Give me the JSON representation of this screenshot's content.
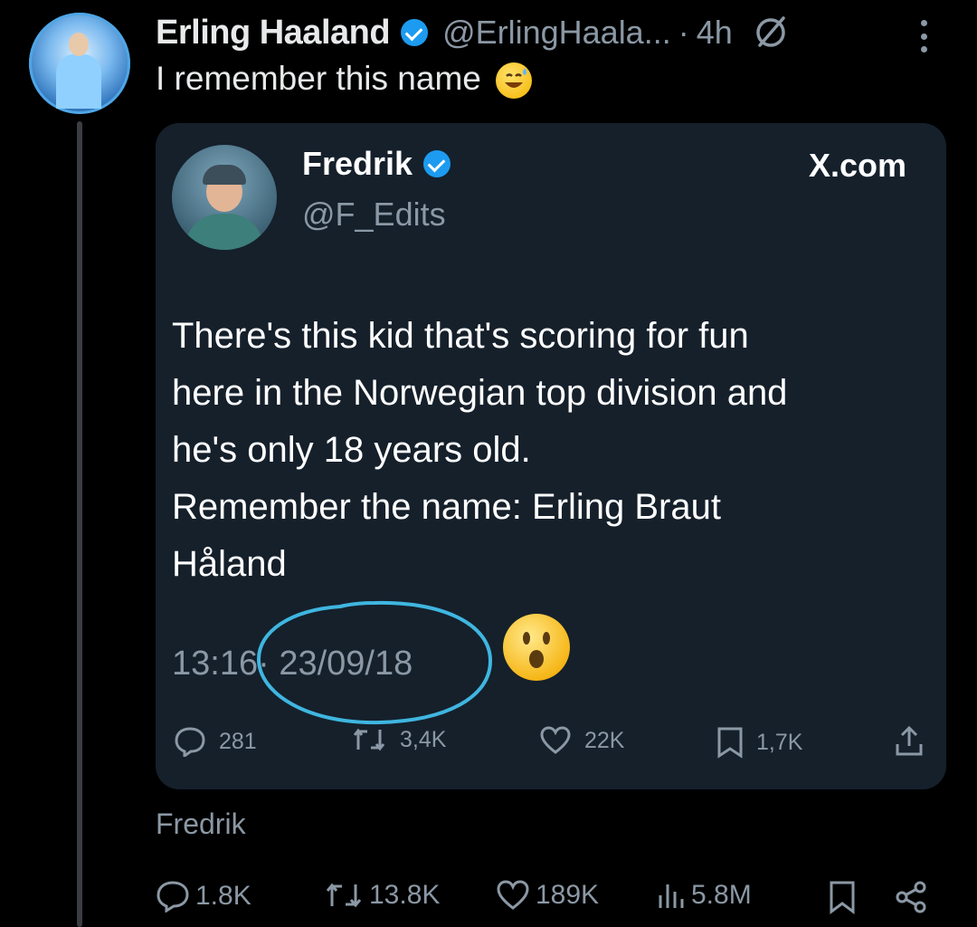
{
  "post": {
    "author_name": "Erling Haaland",
    "handle": "@ErlingHaala...",
    "separator": "·",
    "time": "4h",
    "text": "I remember this name",
    "quoted_source_label": "Fredrik"
  },
  "card": {
    "name": "Fredrik",
    "handle": "@F_Edits",
    "brand": "X.com",
    "body_lines": [
      "There's this kid that's scoring for fun",
      "here in the Norwegian top division and",
      "he's only 18 years old.",
      "Remember the name: Erling Braut",
      "Håland"
    ],
    "time": "13:16",
    "separator": "·",
    "date": "23/09/18",
    "stats": {
      "replies": "281",
      "reposts": "3,4K",
      "likes": "22K",
      "bookmarks": "1,7K"
    }
  },
  "actions": {
    "replies": "1.8K",
    "reposts": "13.8K",
    "likes": "189K",
    "views": "5.8M"
  },
  "icons": {
    "verified": "verified-badge-icon",
    "grok": "grok-icon",
    "more": "more-dots-icon",
    "reply": "reply-icon",
    "repost": "repost-icon",
    "like": "heart-icon",
    "bookmark": "bookmark-icon",
    "share": "share-icon",
    "views": "views-icon"
  },
  "colors": {
    "background": "#000000",
    "card_background": "#15202b",
    "verified": "#1d9bf0",
    "muted_text": "#8b98a5",
    "annotation_circle": "#3fb6e0"
  }
}
